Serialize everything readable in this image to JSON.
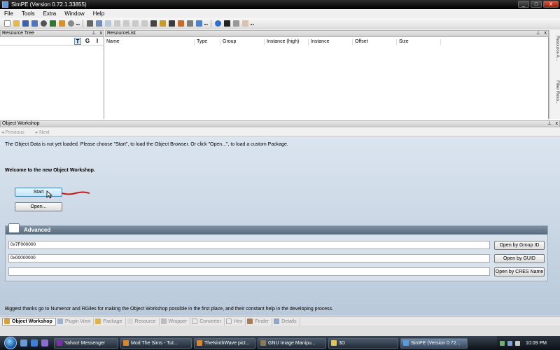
{
  "window": {
    "title": "SimPE (Version 0.72.1.33855)",
    "minimize": "_",
    "maximize": "□",
    "close": "X"
  },
  "menu": [
    "File",
    "Tools",
    "Extra",
    "Window",
    "Help"
  ],
  "resource_tree": {
    "title": "Resource Tree",
    "pin": "⊥",
    "close": "x",
    "tools": [
      "T",
      "G",
      "I"
    ]
  },
  "resource_list": {
    "title": "ResourceList",
    "pin": "⊥",
    "close": "x",
    "columns": [
      "Name",
      "Type",
      "Group",
      "Instance (high)",
      "Instance",
      "Offset",
      "Size"
    ]
  },
  "right_dock": {
    "tabs": [
      "Resource A...",
      "Filter Reso..."
    ]
  },
  "object_workshop": {
    "title": "Object Workshop",
    "pin": "⊥",
    "close": "x",
    "nav_previous": "Previous",
    "nav_next": "Next",
    "notice": "The Object Data is not yet loaded. Please choose \"Start\", to load the Object Browser. Or click \"Open...\", to load a custom Package.",
    "welcome": "Welcome to the new Object Workshop.",
    "start_label": "Start",
    "open_label": "Open...",
    "advanced": {
      "title": "Advanced",
      "group_id_value": "0x7F000000",
      "guid_value": "0x00000000",
      "cres_value": "",
      "open_group_label": "Open by Group ID",
      "open_guid_label": "Open by GUID",
      "open_cres_label": "Open by CRES Name"
    },
    "credits": "Biggest thanks go to Numenor and RGiles for making the Object Workshop possible in the first place, and their constant help in the developing process."
  },
  "bottom_tabs": [
    "Object Workshop",
    "Plugin View",
    "Package",
    "Resource",
    "Wrapper",
    "Converter",
    "Hex",
    "Finder",
    "Details"
  ],
  "taskbar": {
    "tasks": [
      "Yahoo! Messenger",
      "Mod The Sims - Tut...",
      "TheNinthWave pict...",
      "GNU Image Manipu...",
      "3D",
      "SimPE (Version 0.72..."
    ],
    "clock": "10:09 PM"
  },
  "colors": {
    "accent": "#3c7fb1",
    "advanced_header": "#56697c",
    "panel_bg": "#c8d5e3"
  }
}
